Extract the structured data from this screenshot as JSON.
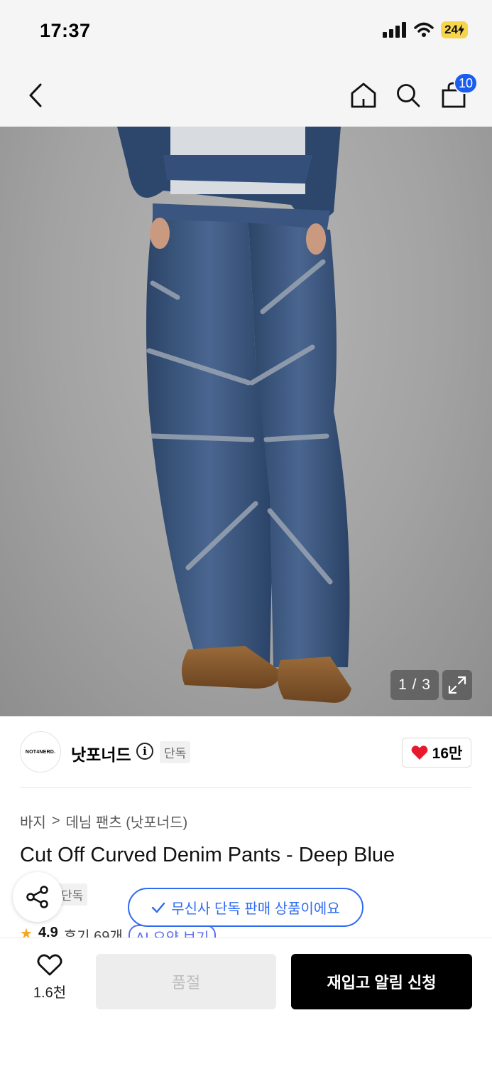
{
  "status_bar": {
    "time": "17:37",
    "battery": "24"
  },
  "nav": {
    "cart_count": "10"
  },
  "gallery": {
    "counter": "1 / 3"
  },
  "brand": {
    "logo_text": "NOT4NERD.",
    "name": "낫포너드",
    "exclusive_tag": "단독",
    "like_count": "16만"
  },
  "breadcrumb": {
    "category": "바지",
    "separator": ">",
    "subcategory": "데님 팬츠 (낫포너드)"
  },
  "product": {
    "title": "Cut Off Curved Denim Pants - Deep Blue",
    "exclusive_tag": "단독"
  },
  "toast": {
    "message": "무신사 단독 판매 상품이에요"
  },
  "rating": {
    "score": "4.9",
    "reviews": "후기 69개",
    "ai_label": "AI 요약 보기"
  },
  "bottom": {
    "wish_count": "1.6천",
    "soldout_label": "품절",
    "restock_label": "재입고 알림 신청"
  },
  "colors": {
    "accent_blue": "#2f6bf2",
    "badge_blue": "#1a5cf0",
    "heart_red": "#e8192c",
    "primary_black": "#000000"
  }
}
